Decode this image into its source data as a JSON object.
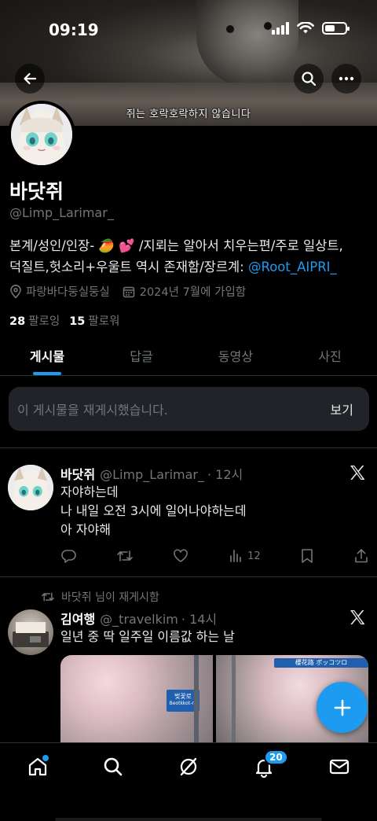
{
  "status_bar": {
    "time": "09:19"
  },
  "banner": {
    "caption": "쥐는 호락호락하지 않습니다"
  },
  "profile": {
    "name": "바닷쥐",
    "handle": "@Limp_Larimar_",
    "bio_line1": "본계/성인/인장- 🥭 💕 /지뢰는 알아서 치우는편/주로 일상트,",
    "bio_line2_text": "덕질트,헛소리+우울트 역시 존재함/장르계: ",
    "bio_link": "@Root_AIPRI_",
    "location": "파랑바다둥실둥실",
    "joined": "2024년 7월에 가입함",
    "following_count": "28",
    "following_label": "팔로잉",
    "followers_count": "15",
    "followers_label": "팔로워"
  },
  "tabs": [
    {
      "label": "게시물",
      "active": true
    },
    {
      "label": "답글",
      "active": false
    },
    {
      "label": "동영상",
      "active": false
    },
    {
      "label": "사진",
      "active": false
    }
  ],
  "repost_notice": {
    "text": "이 게시물을 재게시했습니다.",
    "action": "보기"
  },
  "tweets": [
    {
      "name": "바닷쥐",
      "handle": "@Limp_Larimar_",
      "time": "· 12시",
      "lines": [
        "자야하는데",
        "나 내일 오전 3시에 일어나야하는데",
        "아 자야해"
      ],
      "views": "12"
    },
    {
      "reposted_by": "바닷쥐 님이 재게시함",
      "name": "김여행",
      "handle": "@_travelkim",
      "time": "· 14시",
      "lines": [
        "일년 중 딱 일주일 이름값 하는 날"
      ],
      "media_sign_1": "벚꽃로",
      "media_sign_1_sub": "Beotkkot-ro",
      "media_sign_2": "櫻花路 ポッコツロ"
    }
  ],
  "bottom_nav": {
    "notifications_badge": "20"
  },
  "colors": {
    "accent": "#1d9bf0",
    "background": "#000000",
    "muted": "#71767b"
  }
}
